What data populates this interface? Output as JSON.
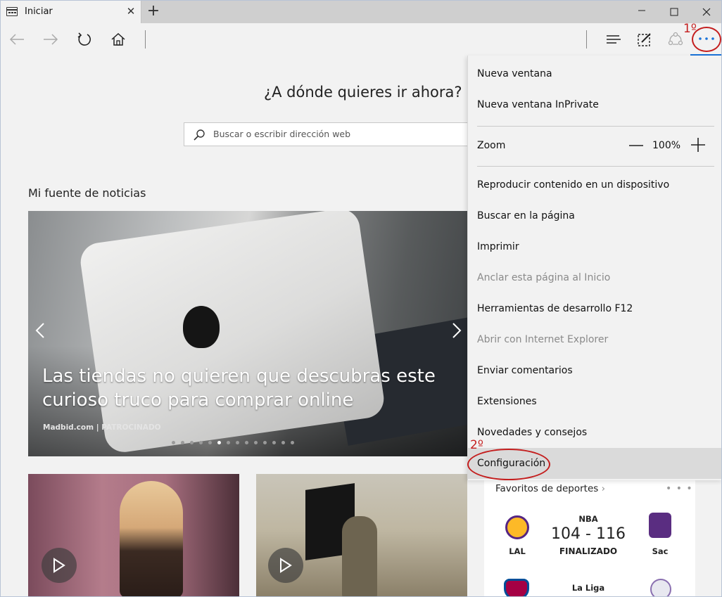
{
  "tab": {
    "title": "Iniciar",
    "close_glyph": "✕",
    "new_tab_glyph": "+"
  },
  "window_controls": {
    "minimize": "—",
    "maximize": "☐",
    "close": "✕"
  },
  "navbar": {
    "icons": [
      "back-icon",
      "forward-icon",
      "refresh-icon",
      "home-icon",
      "hub-icon",
      "web-note-icon",
      "share-icon",
      "more-icon"
    ]
  },
  "start_page": {
    "question": "¿A dónde quieres ir ahora?",
    "search_placeholder": "Buscar o escribir dirección web",
    "news_heading": "Mi fuente de noticias",
    "carousel": {
      "headline": "Las tiendas no quieren que descubras este curioso truco para comprar online",
      "source": "Madbid.com | PATROCINADO",
      "dot_count": 14,
      "active_dot": 5
    },
    "sports": {
      "title": "Favoritos de deportes",
      "chevron": "›",
      "more": "• • •",
      "game1": {
        "league": "NBA",
        "home": "LAL",
        "away": "Sac",
        "score": "104 - 116",
        "status": "FINALIZADO"
      },
      "game2": {
        "league": "La Liga"
      }
    }
  },
  "menu": {
    "items": [
      {
        "label": "Nueva ventana",
        "disabled": false
      },
      {
        "label": "Nueva ventana InPrivate",
        "disabled": false
      },
      {
        "label": "Reproducir contenido en un dispositivo",
        "disabled": false
      },
      {
        "label": "Buscar en la página",
        "disabled": false
      },
      {
        "label": "Imprimir",
        "disabled": false
      },
      {
        "label": "Anclar esta página al Inicio",
        "disabled": true
      },
      {
        "label": "Herramientas de desarrollo F12",
        "disabled": false
      },
      {
        "label": "Abrir con Internet Explorer",
        "disabled": true
      },
      {
        "label": "Enviar comentarios",
        "disabled": false
      },
      {
        "label": "Extensiones",
        "disabled": false
      },
      {
        "label": "Novedades y consejos",
        "disabled": false
      },
      {
        "label": "Configuración",
        "disabled": false
      }
    ],
    "zoom": {
      "label": "Zoom",
      "value": "100%"
    }
  },
  "annotations": {
    "step1": "1º",
    "step2": "2º"
  },
  "colors": {
    "accent": "#1a73d9",
    "annotation": "#c41e1e",
    "menu_bg": "#f2f2f2",
    "hover": "#dadada"
  }
}
